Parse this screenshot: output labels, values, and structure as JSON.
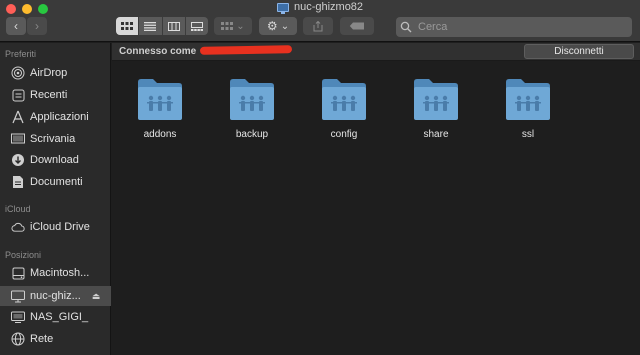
{
  "window": {
    "title": "nuc-ghizmo82"
  },
  "toolbar": {
    "back_glyph": "‹",
    "forward_glyph": "›",
    "search_placeholder": "Cerca"
  },
  "sidebar": {
    "sections": {
      "favorites": "Preferiti",
      "icloud": "iCloud",
      "locations": "Posizioni"
    },
    "favorites": [
      {
        "label": "AirDrop",
        "icon": "airdrop-icon"
      },
      {
        "label": "Recenti",
        "icon": "clock-icon"
      },
      {
        "label": "Applicazioni",
        "icon": "apps-icon"
      },
      {
        "label": "Scrivania",
        "icon": "desktop-icon"
      },
      {
        "label": "Download",
        "icon": "download-icon"
      },
      {
        "label": "Documenti",
        "icon": "document-icon"
      }
    ],
    "icloud": [
      {
        "label": "iCloud Drive",
        "icon": "cloud-icon"
      }
    ],
    "locations": [
      {
        "label": "Macintosh...",
        "icon": "disk-icon"
      },
      {
        "label": "nuc-ghiz...",
        "icon": "computer-icon",
        "selected": true
      },
      {
        "label": "NAS_GIGI_",
        "icon": "server-icon"
      },
      {
        "label": "Rete",
        "icon": "globe-icon"
      }
    ]
  },
  "pathbar": {
    "connected_as": "Connesso come",
    "disconnect_label": "Disconnetti"
  },
  "folders": [
    {
      "name": "addons"
    },
    {
      "name": "backup"
    },
    {
      "name": "config"
    },
    {
      "name": "share"
    },
    {
      "name": "ssl"
    }
  ],
  "colors": {
    "accent_folder": "#6fa8d6",
    "redaction": "#e8311f"
  }
}
